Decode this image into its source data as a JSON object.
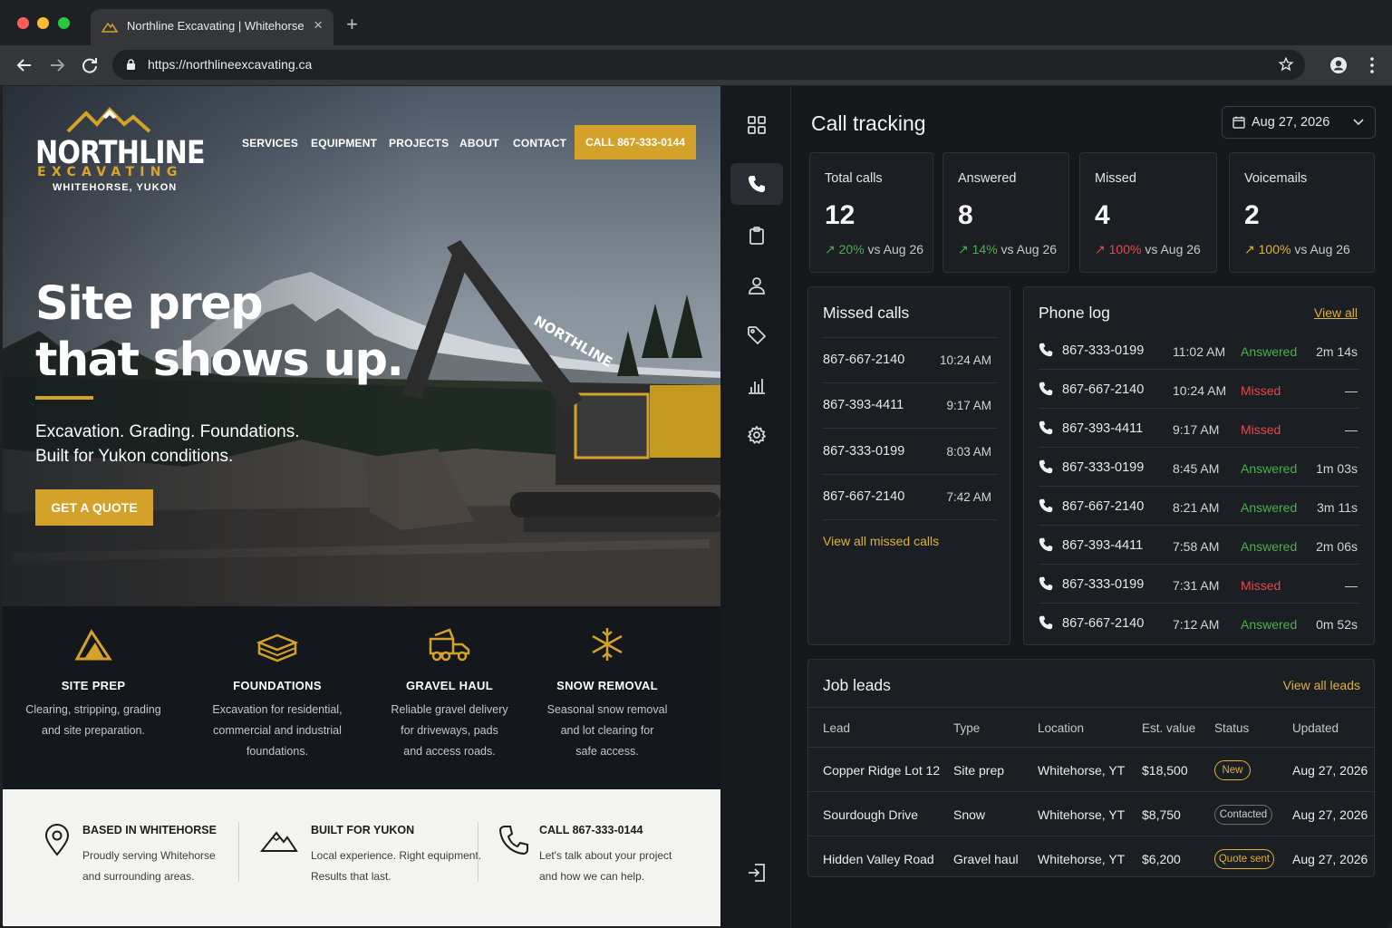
{
  "browser": {
    "tab_title": "Northline Excavating | Whitehorse, YT",
    "url": "https://northlineexcavating.ca"
  },
  "site": {
    "logo": {
      "main": "NORTHLINE",
      "sub": "EXCAVATING",
      "location": "WHITEHORSE, YUKON"
    },
    "nav": [
      "SERVICES",
      "EQUIPMENT",
      "PROJECTS",
      "ABOUT",
      "CONTACT"
    ],
    "call_button": "CALL 867-333-0144",
    "machine_label": "NORTHLINE",
    "hero": {
      "title_line1": "Site prep",
      "title_line2": "that shows up.",
      "sub_line1": "Excavation. Grading. Foundations.",
      "sub_line2": "Built for Yukon conditions.",
      "cta": "GET A QUOTE"
    },
    "services": [
      {
        "icon": "mountain-icon",
        "title": "SITE PREP",
        "lines": [
          "Clearing, stripping, grading",
          "and site preparation."
        ]
      },
      {
        "icon": "foundation-icon",
        "title": "FOUNDATIONS",
        "lines": [
          "Excavation for residential,",
          "commercial and industrial",
          "foundations."
        ]
      },
      {
        "icon": "dump-truck-icon",
        "title": "GRAVEL HAUL",
        "lines": [
          "Reliable gravel delivery",
          "for driveways, pads",
          "and access roads."
        ]
      },
      {
        "icon": "snowflake-icon",
        "title": "SNOW REMOVAL",
        "lines": [
          "Seasonal snow removal",
          "and lot clearing for",
          "safe access."
        ]
      }
    ],
    "features": [
      {
        "icon": "location-pin-icon",
        "title": "BASED IN WHITEHORSE",
        "lines": [
          "Proudly serving Whitehorse",
          "and surrounding areas."
        ]
      },
      {
        "icon": "mountain-outline-icon",
        "title": "BUILT FOR YUKON",
        "lines": [
          "Local experience. Right equipment.",
          "Results that last."
        ]
      },
      {
        "icon": "phone-icon",
        "title": "CALL 867-333-0144",
        "lines": [
          "Let's talk about your project",
          "and how we can help."
        ]
      }
    ]
  },
  "dashboard": {
    "title": "Call tracking",
    "date": "Aug 27, 2026",
    "nav_icons": [
      "grid-icon",
      "phone-icon",
      "clipboard-icon",
      "user-icon",
      "tag-icon",
      "bar-chart-icon",
      "gear-icon",
      "logout-icon"
    ],
    "kpis": [
      {
        "label": "Total calls",
        "value": "12",
        "pct": "20%",
        "vs": "vs Aug 26",
        "color": "#4caf50"
      },
      {
        "label": "Answered",
        "value": "8",
        "pct": "14%",
        "vs": "vs Aug 26",
        "color": "#4caf50"
      },
      {
        "label": "Missed",
        "value": "4",
        "pct": "100%",
        "vs": "vs Aug 26",
        "color": "#e5484d"
      },
      {
        "label": "Voicemails",
        "value": "2",
        "pct": "100%",
        "vs": "vs Aug 26",
        "color": "#e0b13a"
      }
    ],
    "missed_calls": {
      "title": "Missed calls",
      "rows": [
        {
          "number": "867-667-2140",
          "time": "10:24 AM"
        },
        {
          "number": "867-393-4411",
          "time": "9:17 AM"
        },
        {
          "number": "867-333-0199",
          "time": "8:03 AM"
        },
        {
          "number": "867-667-2140",
          "time": "7:42 AM"
        }
      ],
      "link": "View all missed calls"
    },
    "phone_log": {
      "title": "Phone log",
      "link": "View all",
      "rows": [
        {
          "number": "867-333-0199",
          "time": "11:02 AM",
          "status": "Answered",
          "duration": "2m 14s"
        },
        {
          "number": "867-667-2140",
          "time": "10:24 AM",
          "status": "Missed",
          "duration": "—"
        },
        {
          "number": "867-393-4411",
          "time": "9:17 AM",
          "status": "Missed",
          "duration": "—"
        },
        {
          "number": "867-333-0199",
          "time": "8:45 AM",
          "status": "Answered",
          "duration": "1m 03s"
        },
        {
          "number": "867-667-2140",
          "time": "8:21 AM",
          "status": "Answered",
          "duration": "3m 11s"
        },
        {
          "number": "867-393-4411",
          "time": "7:58 AM",
          "status": "Answered",
          "duration": "2m 06s"
        },
        {
          "number": "867-333-0199",
          "time": "7:31 AM",
          "status": "Missed",
          "duration": "—"
        },
        {
          "number": "867-667-2140",
          "time": "7:12 AM",
          "status": "Answered",
          "duration": "0m 52s"
        }
      ]
    },
    "job_leads": {
      "title": "Job leads",
      "link": "View all leads",
      "columns": [
        "Lead",
        "Type",
        "Location",
        "Est. value",
        "Status",
        "Updated"
      ],
      "rows": [
        {
          "lead": "Copper Ridge Lot 12",
          "type": "Site prep",
          "location": "Whitehorse, YT",
          "value": "$18,500",
          "status": "New",
          "updated": "Aug 27, 2026"
        },
        {
          "lead": "Sourdough Drive",
          "type": "Snow",
          "location": "Whitehorse, YT",
          "value": "$8,750",
          "status": "Contacted",
          "updated": "Aug 27, 2026"
        },
        {
          "lead": "Hidden Valley Road",
          "type": "Gravel haul",
          "location": "Whitehorse, YT",
          "value": "$6,200",
          "status": "Quote sent",
          "updated": "Aug 27, 2026"
        }
      ]
    },
    "colors": {
      "accent": "#e0b13a",
      "answered": "#4caf50",
      "missed": "#e5484d"
    }
  }
}
